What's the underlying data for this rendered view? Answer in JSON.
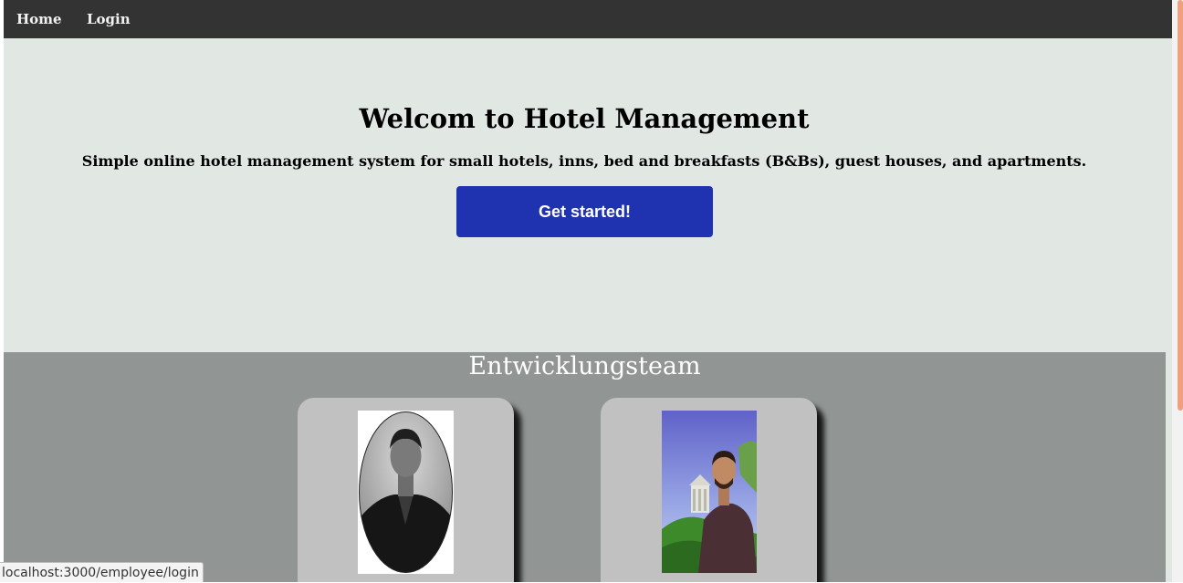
{
  "nav": {
    "home_label": "Home",
    "login_label": "Login"
  },
  "hero": {
    "title": "Welcom to Hotel Management",
    "subtitle": "Simple online hotel management system for small hotels, inns, bed and breakfasts (B&Bs), guest houses, and apartments.",
    "cta_label": "Get started!"
  },
  "team": {
    "title": "Entwicklungsteam",
    "members": [
      {
        "photo": "team-member-photo-grayscale-oval"
      },
      {
        "photo": "team-member-photo-outdoor-park"
      }
    ]
  },
  "status_bar": {
    "url": "localhost:3000/employee/login"
  },
  "colors": {
    "navbar": "#333333",
    "page_background": "#e1e8e4",
    "cta_button": "#1f32b0",
    "team_background": "#919593",
    "card_background": "#c1c1c1",
    "scrollbar_thumb": "#f0a07e"
  }
}
